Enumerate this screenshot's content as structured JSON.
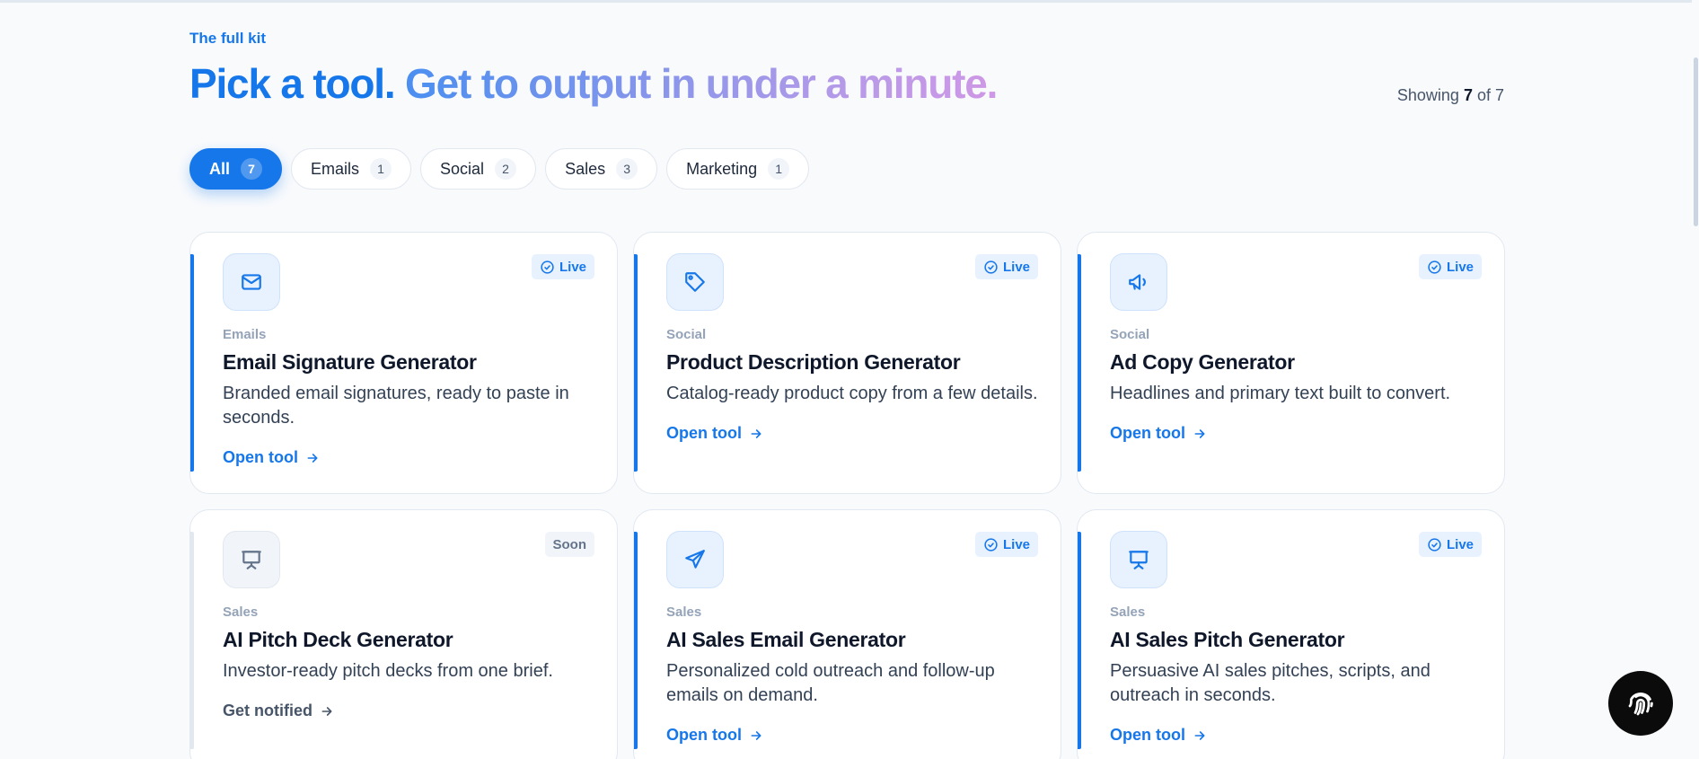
{
  "header": {
    "eyebrow": "The full kit",
    "headline_part1": "Pick a tool.",
    "headline_part2": "Get to output in under a minute.",
    "showing_prefix": "Showing",
    "showing_count": "7",
    "showing_suffix": "of 7"
  },
  "filters": [
    {
      "label": "All",
      "count": "7",
      "active": true
    },
    {
      "label": "Emails",
      "count": "1"
    },
    {
      "label": "Social",
      "count": "2"
    },
    {
      "label": "Sales",
      "count": "3"
    },
    {
      "label": "Marketing",
      "count": "1"
    }
  ],
  "cards": [
    {
      "icon": "mail-icon",
      "badge": "Live",
      "category": "Emails",
      "title": "Email Signature Generator",
      "description": "Branded email signatures, ready to paste in seconds.",
      "cta": "Open tool"
    },
    {
      "icon": "tag-icon",
      "badge": "Live",
      "category": "Social",
      "title": "Product Description Generator",
      "description": "Catalog-ready product copy from a few details.",
      "cta": "Open tool"
    },
    {
      "icon": "megaphone-icon",
      "badge": "Live",
      "category": "Social",
      "title": "Ad Copy Generator",
      "description": "Headlines and primary text built to convert.",
      "cta": "Open tool"
    },
    {
      "icon": "presentation-icon",
      "badge": "Soon",
      "category": "Sales",
      "title": "AI Pitch Deck Generator",
      "description": "Investor-ready pitch decks from one brief.",
      "cta": "Get notified"
    },
    {
      "icon": "send-icon",
      "badge": "Live",
      "category": "Sales",
      "title": "AI Sales Email Generator",
      "description": "Personalized cold outreach and follow-up emails on demand.",
      "cta": "Open tool"
    },
    {
      "icon": "presentation-icon",
      "badge": "Live",
      "category": "Sales",
      "title": "AI Sales Pitch Generator",
      "description": "Persuasive AI sales pitches, scripts, and outreach in seconds.",
      "cta": "Open tool"
    }
  ],
  "fab": {
    "icon": "fingerprint-icon"
  },
  "colors": {
    "accent": "#1677ea",
    "soon_gray": "#64748b",
    "background": "#f8fafc"
  }
}
